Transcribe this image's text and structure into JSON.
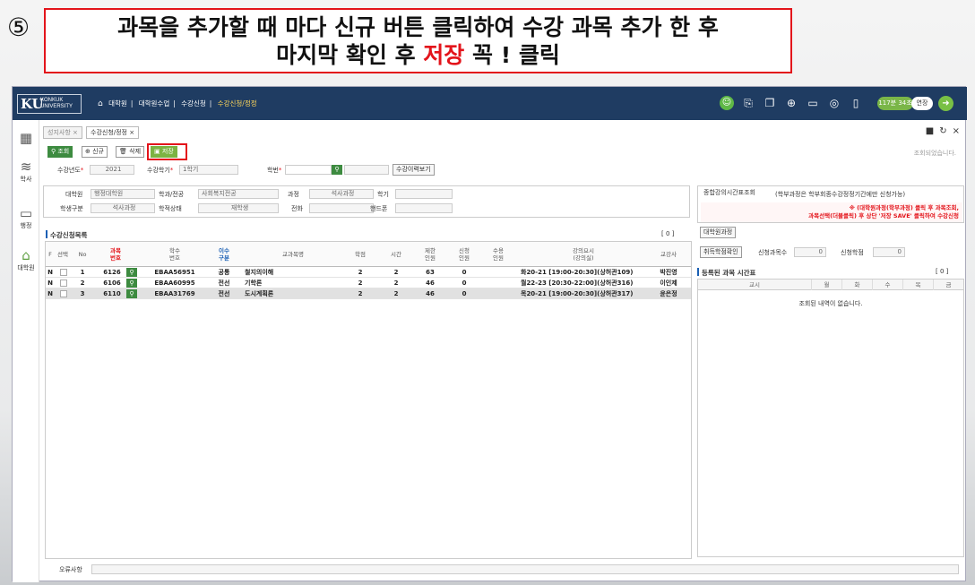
{
  "instruction": {
    "step_marker": "⑤",
    "line1": "과목을 추가할 때 마다 신규 버튼 클릭하여 수강 과목 추가 한 후",
    "line2_before": "마지막 확인 후 ",
    "line2_red": "저장",
    "line2_after": " 꼭 ! 클릭"
  },
  "header": {
    "logo_main": "KU",
    "logo_line1": "KONKUK",
    "logo_line2": "UNIVERSITY",
    "breadcrumb": [
      "대학원",
      "대학원수업",
      "수강신청",
      "수강신청/정정"
    ],
    "timer": "117분 34초",
    "extend_label": "연장",
    "icons": [
      "user-icon",
      "search-doc-icon",
      "copy-icon",
      "zoom-icon",
      "monitor-icon",
      "location-icon",
      "bookmark-icon",
      "logout-icon"
    ]
  },
  "sidebar": [
    {
      "icon": "grid-icon",
      "label": ""
    },
    {
      "icon": "layers-icon",
      "label": "학사"
    },
    {
      "icon": "monitor-icon",
      "label": "행정"
    },
    {
      "icon": "building-icon",
      "label": "대학원"
    }
  ],
  "tabs": [
    "성지사항 ×",
    "수강신청/정정 ×"
  ],
  "toolbar": {
    "search": "조회",
    "new": "신규",
    "delete": "삭제",
    "save": "저장",
    "status_message": "조회되었습니다."
  },
  "filters": {
    "year_label": "수강년도",
    "year_value": "2021",
    "term_label": "수강학기",
    "term_value": "1학기",
    "student_id_label": "학번",
    "student_id_value": "",
    "history_button": "수강이력보기"
  },
  "info": {
    "college_label": "대학원",
    "college_value": "행정대학원",
    "dept_label": "학과/전공",
    "dept_value": "사회복지전공",
    "course_label": "과정",
    "course_value": "석사과정",
    "semester_label": "학기",
    "semester_value": "",
    "type_label": "학생구분",
    "type_value": "석사과정",
    "status_label": "학적상태",
    "status_value": "재학생",
    "phone_label": "전화",
    "phone_value": "",
    "mobile_label": "핸드폰",
    "mobile_value": ""
  },
  "list": {
    "title": "수강신청목록",
    "count": "[ 0 ]",
    "columns": [
      "F",
      "선택",
      "No",
      "과목\n번호",
      "학수\n번호",
      "이수\n구분",
      "교과목명",
      "학점",
      "시간",
      "제한\n인원",
      "신청\n인원",
      "수용\n인원",
      "강의요시\n(강의실)",
      "교강사"
    ],
    "rows": [
      {
        "f": "N",
        "no": "1",
        "subj_no": "6126",
        "course_code": "EBAA56951",
        "category": "공통",
        "name": "철지의이해",
        "credit": "2",
        "hours": "2",
        "limit": "63",
        "applied": "0",
        "capacity": "",
        "schedule": "화20-21 [19:00-20:30](상허관109)",
        "instructor": "박진영"
      },
      {
        "f": "N",
        "no": "2",
        "subj_no": "6106",
        "course_code": "EBAA60995",
        "category": "전선",
        "name": "기학론",
        "credit": "2",
        "hours": "2",
        "limit": "46",
        "applied": "0",
        "capacity": "",
        "schedule": "월22-23 [20:30-22:00](상허관316)",
        "instructor": "이인제"
      },
      {
        "f": "N",
        "no": "3",
        "subj_no": "6110",
        "course_code": "EBAA31769",
        "category": "전선",
        "name": "도시계획론",
        "credit": "2",
        "hours": "2",
        "limit": "46",
        "applied": "0",
        "capacity": "",
        "schedule": "목20-21 [19:00-20:30](상허관317)",
        "instructor": "윤은정"
      }
    ]
  },
  "right": {
    "timetable_btn": "종합강의시간표조회",
    "notice_top": "(학부과정은 학부회종수강정정기간에만 신청가능)",
    "notice_line1": "※ (대학원과정(학부과정) 클릭 후 과목조회,",
    "notice_line2": "과목선택(더블클릭) 후 상단 '저장 SAVE' 클릭하여 수강신청",
    "grad_btn": "대학원과정",
    "credit_check_btn": "취득학점확인",
    "count_label": "신청과목수",
    "count_value": "0",
    "credit_label": "신청학점",
    "credit_value": "0",
    "timetable_title": "등록된 과목 시간표",
    "timetable_count": "[ 0 ]",
    "timetable_cols": [
      "교시",
      "월",
      "화",
      "수",
      "목",
      "금"
    ],
    "empty_text": "조회된 내역이 없습니다."
  },
  "footer": {
    "error_label": "오류사항"
  }
}
